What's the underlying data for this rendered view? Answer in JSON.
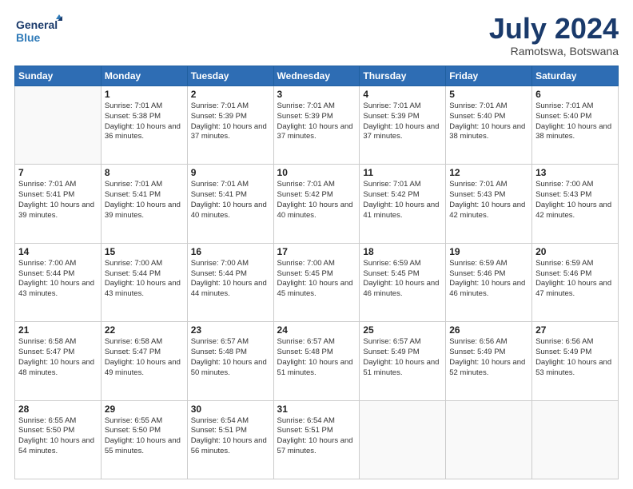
{
  "header": {
    "logo_line1": "General",
    "logo_line2": "Blue",
    "month_year": "July 2024",
    "location": "Ramotswa, Botswana"
  },
  "weekdays": [
    "Sunday",
    "Monday",
    "Tuesday",
    "Wednesday",
    "Thursday",
    "Friday",
    "Saturday"
  ],
  "weeks": [
    [
      {
        "day": "",
        "info": ""
      },
      {
        "day": "1",
        "info": "Sunrise: 7:01 AM\nSunset: 5:38 PM\nDaylight: 10 hours\nand 36 minutes."
      },
      {
        "day": "2",
        "info": "Sunrise: 7:01 AM\nSunset: 5:39 PM\nDaylight: 10 hours\nand 37 minutes."
      },
      {
        "day": "3",
        "info": "Sunrise: 7:01 AM\nSunset: 5:39 PM\nDaylight: 10 hours\nand 37 minutes."
      },
      {
        "day": "4",
        "info": "Sunrise: 7:01 AM\nSunset: 5:39 PM\nDaylight: 10 hours\nand 37 minutes."
      },
      {
        "day": "5",
        "info": "Sunrise: 7:01 AM\nSunset: 5:40 PM\nDaylight: 10 hours\nand 38 minutes."
      },
      {
        "day": "6",
        "info": "Sunrise: 7:01 AM\nSunset: 5:40 PM\nDaylight: 10 hours\nand 38 minutes."
      }
    ],
    [
      {
        "day": "7",
        "info": "Sunrise: 7:01 AM\nSunset: 5:41 PM\nDaylight: 10 hours\nand 39 minutes."
      },
      {
        "day": "8",
        "info": "Sunrise: 7:01 AM\nSunset: 5:41 PM\nDaylight: 10 hours\nand 39 minutes."
      },
      {
        "day": "9",
        "info": "Sunrise: 7:01 AM\nSunset: 5:41 PM\nDaylight: 10 hours\nand 40 minutes."
      },
      {
        "day": "10",
        "info": "Sunrise: 7:01 AM\nSunset: 5:42 PM\nDaylight: 10 hours\nand 40 minutes."
      },
      {
        "day": "11",
        "info": "Sunrise: 7:01 AM\nSunset: 5:42 PM\nDaylight: 10 hours\nand 41 minutes."
      },
      {
        "day": "12",
        "info": "Sunrise: 7:01 AM\nSunset: 5:43 PM\nDaylight: 10 hours\nand 42 minutes."
      },
      {
        "day": "13",
        "info": "Sunrise: 7:00 AM\nSunset: 5:43 PM\nDaylight: 10 hours\nand 42 minutes."
      }
    ],
    [
      {
        "day": "14",
        "info": "Sunrise: 7:00 AM\nSunset: 5:44 PM\nDaylight: 10 hours\nand 43 minutes."
      },
      {
        "day": "15",
        "info": "Sunrise: 7:00 AM\nSunset: 5:44 PM\nDaylight: 10 hours\nand 43 minutes."
      },
      {
        "day": "16",
        "info": "Sunrise: 7:00 AM\nSunset: 5:44 PM\nDaylight: 10 hours\nand 44 minutes."
      },
      {
        "day": "17",
        "info": "Sunrise: 7:00 AM\nSunset: 5:45 PM\nDaylight: 10 hours\nand 45 minutes."
      },
      {
        "day": "18",
        "info": "Sunrise: 6:59 AM\nSunset: 5:45 PM\nDaylight: 10 hours\nand 46 minutes."
      },
      {
        "day": "19",
        "info": "Sunrise: 6:59 AM\nSunset: 5:46 PM\nDaylight: 10 hours\nand 46 minutes."
      },
      {
        "day": "20",
        "info": "Sunrise: 6:59 AM\nSunset: 5:46 PM\nDaylight: 10 hours\nand 47 minutes."
      }
    ],
    [
      {
        "day": "21",
        "info": "Sunrise: 6:58 AM\nSunset: 5:47 PM\nDaylight: 10 hours\nand 48 minutes."
      },
      {
        "day": "22",
        "info": "Sunrise: 6:58 AM\nSunset: 5:47 PM\nDaylight: 10 hours\nand 49 minutes."
      },
      {
        "day": "23",
        "info": "Sunrise: 6:57 AM\nSunset: 5:48 PM\nDaylight: 10 hours\nand 50 minutes."
      },
      {
        "day": "24",
        "info": "Sunrise: 6:57 AM\nSunset: 5:48 PM\nDaylight: 10 hours\nand 51 minutes."
      },
      {
        "day": "25",
        "info": "Sunrise: 6:57 AM\nSunset: 5:49 PM\nDaylight: 10 hours\nand 51 minutes."
      },
      {
        "day": "26",
        "info": "Sunrise: 6:56 AM\nSunset: 5:49 PM\nDaylight: 10 hours\nand 52 minutes."
      },
      {
        "day": "27",
        "info": "Sunrise: 6:56 AM\nSunset: 5:49 PM\nDaylight: 10 hours\nand 53 minutes."
      }
    ],
    [
      {
        "day": "28",
        "info": "Sunrise: 6:55 AM\nSunset: 5:50 PM\nDaylight: 10 hours\nand 54 minutes."
      },
      {
        "day": "29",
        "info": "Sunrise: 6:55 AM\nSunset: 5:50 PM\nDaylight: 10 hours\nand 55 minutes."
      },
      {
        "day": "30",
        "info": "Sunrise: 6:54 AM\nSunset: 5:51 PM\nDaylight: 10 hours\nand 56 minutes."
      },
      {
        "day": "31",
        "info": "Sunrise: 6:54 AM\nSunset: 5:51 PM\nDaylight: 10 hours\nand 57 minutes."
      },
      {
        "day": "",
        "info": ""
      },
      {
        "day": "",
        "info": ""
      },
      {
        "day": "",
        "info": ""
      }
    ]
  ]
}
